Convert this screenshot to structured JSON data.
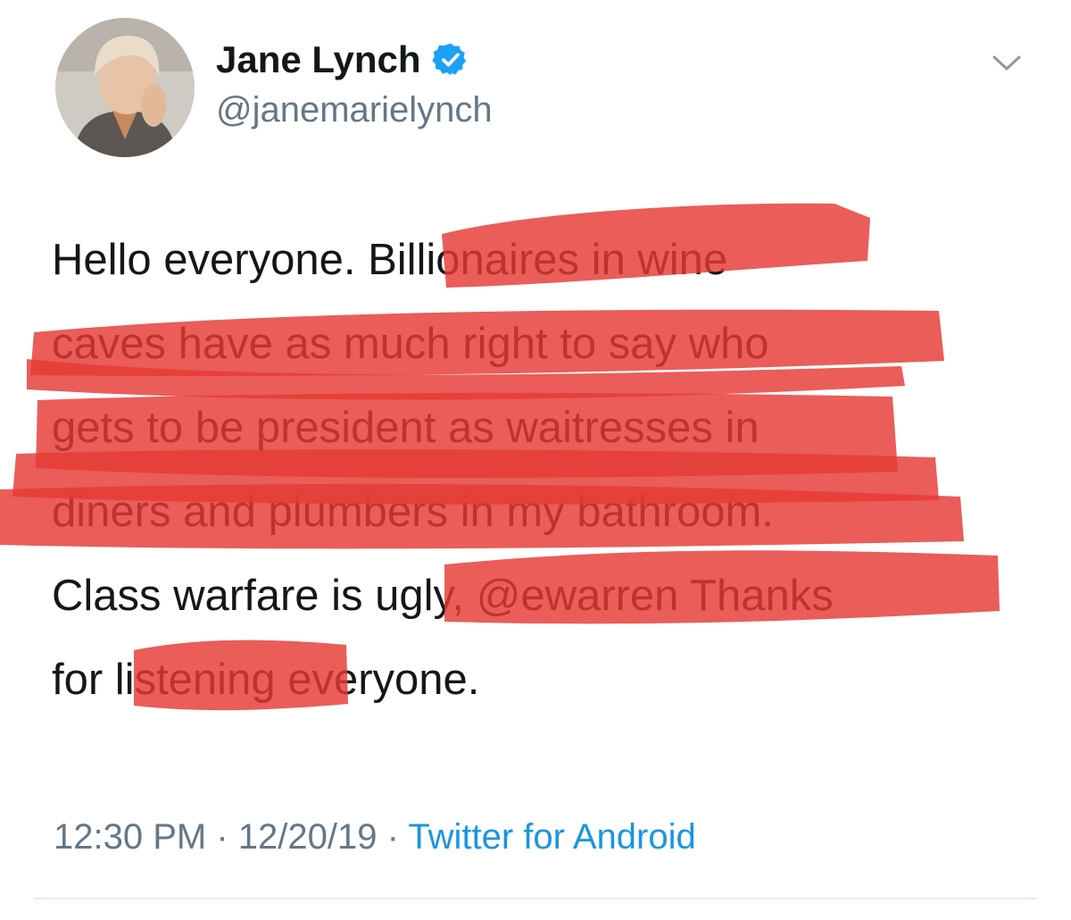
{
  "tweet": {
    "author": {
      "display_name": "Jane Lynch",
      "handle": "@janemarielynch",
      "verified": true,
      "avatar_icon": "profile-photo"
    },
    "menu_icon": "chevron-down-icon",
    "lines": [
      "Hello everyone. Billionaires in wine",
      "caves have as much right to say who",
      "gets to be president as waitresses in",
      "diners and plumbers in my bathroom.",
      "Class warfare is ugly, @ewarren Thanks",
      "for listening everyone."
    ],
    "redaction_color": "#e53935",
    "time": "12:30 PM",
    "separator": "·",
    "date": "12/20/19",
    "source": "Twitter for Android"
  },
  "colors": {
    "text": "#14171a",
    "secondary": "#657786",
    "link": "#1b95e0",
    "verified": "#1da1f2"
  }
}
